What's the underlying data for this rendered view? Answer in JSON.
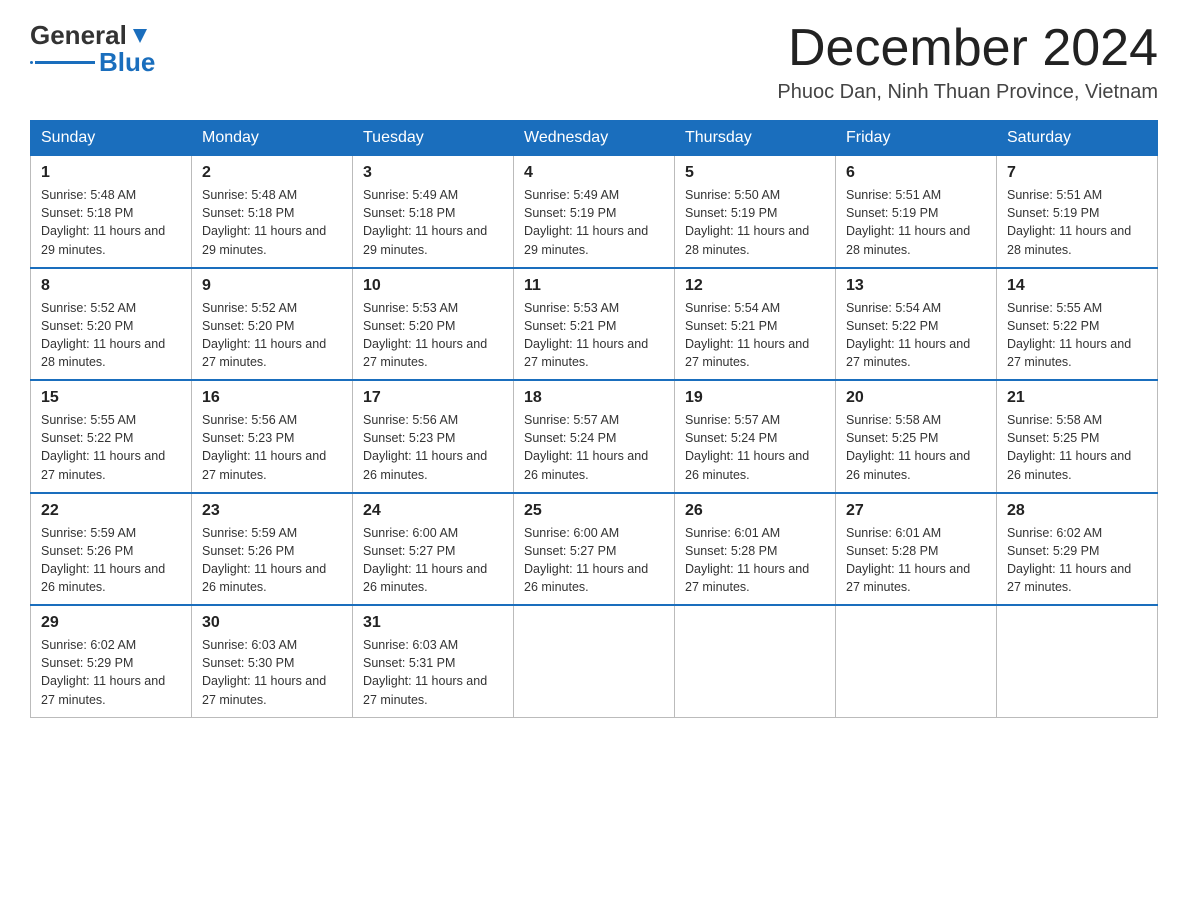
{
  "logo": {
    "text_general": "General",
    "text_blue": "Blue"
  },
  "header": {
    "month_title": "December 2024",
    "location": "Phuoc Dan, Ninh Thuan Province, Vietnam"
  },
  "days_of_week": [
    "Sunday",
    "Monday",
    "Tuesday",
    "Wednesday",
    "Thursday",
    "Friday",
    "Saturday"
  ],
  "weeks": [
    [
      {
        "day": "1",
        "sunrise": "5:48 AM",
        "sunset": "5:18 PM",
        "daylight": "11 hours and 29 minutes."
      },
      {
        "day": "2",
        "sunrise": "5:48 AM",
        "sunset": "5:18 PM",
        "daylight": "11 hours and 29 minutes."
      },
      {
        "day": "3",
        "sunrise": "5:49 AM",
        "sunset": "5:18 PM",
        "daylight": "11 hours and 29 minutes."
      },
      {
        "day": "4",
        "sunrise": "5:49 AM",
        "sunset": "5:19 PM",
        "daylight": "11 hours and 29 minutes."
      },
      {
        "day": "5",
        "sunrise": "5:50 AM",
        "sunset": "5:19 PM",
        "daylight": "11 hours and 28 minutes."
      },
      {
        "day": "6",
        "sunrise": "5:51 AM",
        "sunset": "5:19 PM",
        "daylight": "11 hours and 28 minutes."
      },
      {
        "day": "7",
        "sunrise": "5:51 AM",
        "sunset": "5:19 PM",
        "daylight": "11 hours and 28 minutes."
      }
    ],
    [
      {
        "day": "8",
        "sunrise": "5:52 AM",
        "sunset": "5:20 PM",
        "daylight": "11 hours and 28 minutes."
      },
      {
        "day": "9",
        "sunrise": "5:52 AM",
        "sunset": "5:20 PM",
        "daylight": "11 hours and 27 minutes."
      },
      {
        "day": "10",
        "sunrise": "5:53 AM",
        "sunset": "5:20 PM",
        "daylight": "11 hours and 27 minutes."
      },
      {
        "day": "11",
        "sunrise": "5:53 AM",
        "sunset": "5:21 PM",
        "daylight": "11 hours and 27 minutes."
      },
      {
        "day": "12",
        "sunrise": "5:54 AM",
        "sunset": "5:21 PM",
        "daylight": "11 hours and 27 minutes."
      },
      {
        "day": "13",
        "sunrise": "5:54 AM",
        "sunset": "5:22 PM",
        "daylight": "11 hours and 27 minutes."
      },
      {
        "day": "14",
        "sunrise": "5:55 AM",
        "sunset": "5:22 PM",
        "daylight": "11 hours and 27 minutes."
      }
    ],
    [
      {
        "day": "15",
        "sunrise": "5:55 AM",
        "sunset": "5:22 PM",
        "daylight": "11 hours and 27 minutes."
      },
      {
        "day": "16",
        "sunrise": "5:56 AM",
        "sunset": "5:23 PM",
        "daylight": "11 hours and 27 minutes."
      },
      {
        "day": "17",
        "sunrise": "5:56 AM",
        "sunset": "5:23 PM",
        "daylight": "11 hours and 26 minutes."
      },
      {
        "day": "18",
        "sunrise": "5:57 AM",
        "sunset": "5:24 PM",
        "daylight": "11 hours and 26 minutes."
      },
      {
        "day": "19",
        "sunrise": "5:57 AM",
        "sunset": "5:24 PM",
        "daylight": "11 hours and 26 minutes."
      },
      {
        "day": "20",
        "sunrise": "5:58 AM",
        "sunset": "5:25 PM",
        "daylight": "11 hours and 26 minutes."
      },
      {
        "day": "21",
        "sunrise": "5:58 AM",
        "sunset": "5:25 PM",
        "daylight": "11 hours and 26 minutes."
      }
    ],
    [
      {
        "day": "22",
        "sunrise": "5:59 AM",
        "sunset": "5:26 PM",
        "daylight": "11 hours and 26 minutes."
      },
      {
        "day": "23",
        "sunrise": "5:59 AM",
        "sunset": "5:26 PM",
        "daylight": "11 hours and 26 minutes."
      },
      {
        "day": "24",
        "sunrise": "6:00 AM",
        "sunset": "5:27 PM",
        "daylight": "11 hours and 26 minutes."
      },
      {
        "day": "25",
        "sunrise": "6:00 AM",
        "sunset": "5:27 PM",
        "daylight": "11 hours and 26 minutes."
      },
      {
        "day": "26",
        "sunrise": "6:01 AM",
        "sunset": "5:28 PM",
        "daylight": "11 hours and 27 minutes."
      },
      {
        "day": "27",
        "sunrise": "6:01 AM",
        "sunset": "5:28 PM",
        "daylight": "11 hours and 27 minutes."
      },
      {
        "day": "28",
        "sunrise": "6:02 AM",
        "sunset": "5:29 PM",
        "daylight": "11 hours and 27 minutes."
      }
    ],
    [
      {
        "day": "29",
        "sunrise": "6:02 AM",
        "sunset": "5:29 PM",
        "daylight": "11 hours and 27 minutes."
      },
      {
        "day": "30",
        "sunrise": "6:03 AM",
        "sunset": "5:30 PM",
        "daylight": "11 hours and 27 minutes."
      },
      {
        "day": "31",
        "sunrise": "6:03 AM",
        "sunset": "5:31 PM",
        "daylight": "11 hours and 27 minutes."
      },
      null,
      null,
      null,
      null
    ]
  ],
  "labels": {
    "sunrise": "Sunrise:",
    "sunset": "Sunset:",
    "daylight": "Daylight:"
  }
}
